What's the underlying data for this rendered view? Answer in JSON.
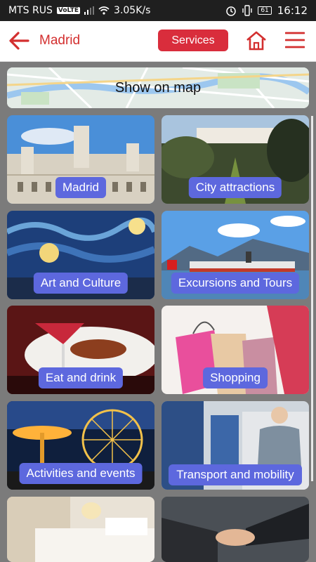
{
  "status": {
    "carrier": "MTS RUS",
    "volte": "VoLTE",
    "speed": "3.05K/s",
    "battery": "61",
    "time": "16:12"
  },
  "appbar": {
    "title": "Madrid",
    "services_label": "Services"
  },
  "map": {
    "label": "Show on map"
  },
  "tiles": [
    {
      "label": "Madrid"
    },
    {
      "label": "City attractions"
    },
    {
      "label": "Art and Culture"
    },
    {
      "label": "Excursions and Tours"
    },
    {
      "label": "Eat and drink"
    },
    {
      "label": "Shopping"
    },
    {
      "label": "Activities and events"
    },
    {
      "label": "Transport and mobility"
    },
    {
      "label": ""
    },
    {
      "label": ""
    }
  ],
  "colors": {
    "accent": "#d32f2f",
    "services_button": "#d92d3c",
    "pill": "#5d68de"
  }
}
